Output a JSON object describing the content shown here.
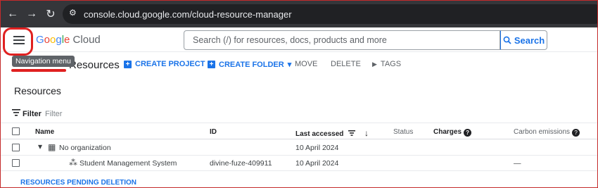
{
  "browser": {
    "url": "console.cloud.google.com/cloud-resource-manager",
    "back_icon": "←",
    "forward_icon": "→",
    "reload_icon": "↻",
    "site_icon": "⚙"
  },
  "header": {
    "menu_icon": "≡",
    "logo_g": "G",
    "logo_o1": "o",
    "logo_o2": "o",
    "logo_g2": "g",
    "logo_l": "l",
    "logo_e": "e",
    "logo_cloud": " Cloud",
    "search_placeholder": "Search (/) for resources, docs, products and more",
    "search_button": "Search",
    "search_icon": "🔍"
  },
  "tooltip": "Navigation menu",
  "toolbar": {
    "title": "Resources",
    "create_project": "CREATE PROJECT",
    "create_folder": "CREATE FOLDER",
    "move": "MOVE",
    "delete": "DELETE",
    "tags": "TAGS",
    "plus_icon": "+",
    "folder_icon": "+",
    "dropdown_icon": "▾",
    "tag_icon": "▶"
  },
  "section_title": "Resources",
  "filter": {
    "label": "Filter",
    "placeholder": "Filter",
    "icon": "☰"
  },
  "table": {
    "columns": {
      "name": "Name",
      "id": "ID",
      "last_accessed": "Last accessed",
      "status": "Status",
      "charges": "Charges",
      "carbon": "Carbon emissions"
    },
    "sort_icon": "↓",
    "help_icon": "?",
    "rows": [
      {
        "expander": "▾",
        "icon": "▦",
        "name": "No organization",
        "id": "",
        "last_accessed": "10 April 2024",
        "carbon": ""
      },
      {
        "expander": "",
        "icon": "⁂",
        "name": "Student Management System",
        "id": "divine-fuze-409911",
        "last_accessed": "10 April 2024",
        "carbon": "—"
      }
    ]
  },
  "pending_link": "RESOURCES PENDING DELETION",
  "colors": {
    "accent": "#1a73e8",
    "annotation_red": "#e02020",
    "browser_bar": "#35363a"
  }
}
